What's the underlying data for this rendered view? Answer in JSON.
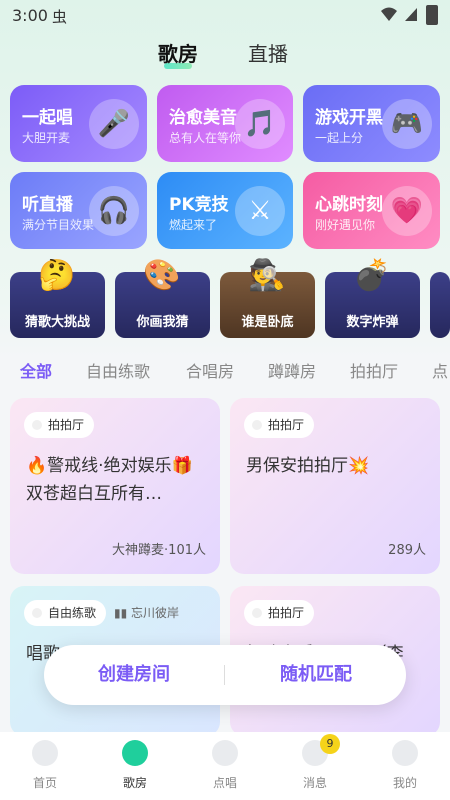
{
  "status": {
    "time": "3:00",
    "bug_glyph": "虫"
  },
  "top_tabs": [
    "歌房",
    "直播"
  ],
  "cards": [
    {
      "title": "一起唱",
      "subtitle": "大胆开麦",
      "icon": "microphone-icon"
    },
    {
      "title": "治愈美音",
      "subtitle": "总有人在等你",
      "icon": "music-note-icon"
    },
    {
      "title": "游戏开黑",
      "subtitle": "一起上分",
      "icon": "gamepad-icon"
    },
    {
      "title": "听直播",
      "subtitle": "满分节目效果",
      "icon": "headphones-icon"
    },
    {
      "title": "PK竞技",
      "subtitle": "燃起来了",
      "icon": "crossed-swords-icon"
    },
    {
      "title": "心跳时刻",
      "subtitle": "刚好遇见你",
      "icon": "heart-icon"
    }
  ],
  "games": [
    {
      "label": "猜歌大挑战",
      "icon": "thinking-face-icon"
    },
    {
      "label": "你画我猜",
      "icon": "palette-icon"
    },
    {
      "label": "谁是卧底",
      "icon": "detective-hat-icon"
    },
    {
      "label": "数字炸弹",
      "icon": "bomb-icon"
    }
  ],
  "categories": [
    "全部",
    "自由练歌",
    "合唱房",
    "蹲蹲房",
    "拍拍厅",
    "点"
  ],
  "rooms": [
    {
      "tag": "拍拍厅",
      "title": "🔥警戒线·绝对娱乐🎁双苍超白互所有…",
      "count": "大神蹲麦·101人"
    },
    {
      "tag": "拍拍厅",
      "title": "男保安拍拍厅💥",
      "count": "289人"
    },
    {
      "tag": "自由练歌",
      "sub": "忘川彼岸",
      "title": "唱歌"
    },
    {
      "tag": "拍拍厅",
      "title": "极速交受一30天（李"
    }
  ],
  "float_bar": {
    "create": "创建房间",
    "match": "随机匹配"
  },
  "nav": [
    {
      "label": "首页"
    },
    {
      "label": "歌房"
    },
    {
      "label": "点唱"
    },
    {
      "label": "消息",
      "badge": "9"
    },
    {
      "label": "我的"
    }
  ],
  "colors": {
    "accent": "#7b5cf5",
    "nav_active": "#1fcf9c"
  }
}
